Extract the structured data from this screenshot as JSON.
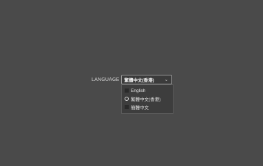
{
  "language": {
    "label": "LANGUAGE",
    "selected_value": "繁體中文(香港)",
    "options": [
      {
        "label": "English",
        "selected": false
      },
      {
        "label": "繁體中文(香港)",
        "selected": true
      },
      {
        "label": "簡體中文",
        "selected": false
      }
    ]
  },
  "icons": {
    "dropdown": "chevron-down-icon"
  }
}
